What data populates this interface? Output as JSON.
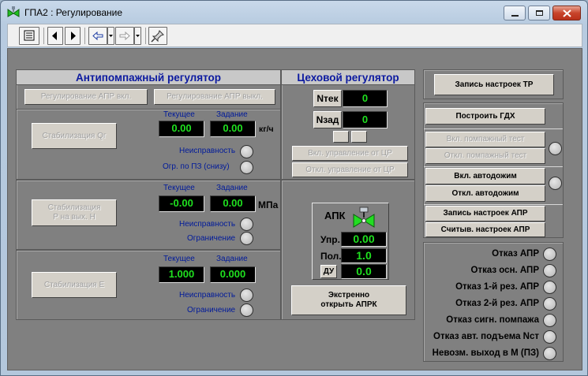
{
  "window": {
    "title": "ГПА2 : Регулирование"
  },
  "antisurge": {
    "header": "Антипомпажный регулятор",
    "btn_apr_on": "Регулирование АПР вкл.",
    "btn_apr_off": "Регулирование АПР выкл.",
    "col_current": "Текущее",
    "col_setpoint": "Задание",
    "blocks": [
      {
        "button": "Стабилизация Qг",
        "current": "0.00",
        "setpoint": "0.00",
        "unit": "кг/ч",
        "lamp1": "Неисправность",
        "lamp2": "Огр. по ПЗ (снизу)"
      },
      {
        "button": "Стабилизация\nР на вых. Н",
        "current": "-0.00",
        "setpoint": "0.00",
        "unit": "МПа",
        "lamp1": "Неисправность",
        "lamp2": "Ограничение"
      },
      {
        "button": "Стабилизация Е",
        "current": "1.000",
        "setpoint": "0.000",
        "unit": "",
        "lamp1": "Неисправность",
        "lamp2": "Ограничение"
      }
    ]
  },
  "shop": {
    "header": "Цеховой регулятор",
    "ntek_label": "Nтек",
    "ntek_value": "0",
    "nzad_label": "Nзад",
    "nzad_value": "0",
    "btn_ctrl_on": "Вкл. управление от ЦР",
    "btn_ctrl_off": "Откл. управление от ЦР"
  },
  "apk": {
    "title": "АПК",
    "upr_label": "Упр.",
    "upr_value": "0.00",
    "pol_label": "Пол.",
    "pol_value": "1.0",
    "du_label": "ДУ",
    "du_value": "0.0",
    "emergency_btn": "Экстренно\nоткрыть АПРК"
  },
  "right": {
    "btn_write_tr": "Запись настроек ТР",
    "btn_build_gdh": "Построить ГДХ",
    "btn_surge_test_on": "Вкл. помпажный тест",
    "btn_surge_test_off": "Откл. помпажный тест",
    "btn_autoclamp_on": "Вкл. автодожим",
    "btn_autoclamp_off": "Откл. автодожим",
    "btn_write_apr": "Запись настроек АПР",
    "btn_read_apr": "Считыв. настроек АПР",
    "faults": [
      "Отказ АПР",
      "Отказ осн. АПР",
      "Отказ 1-й рез. АПР",
      "Отказ 2-й рез. АПР",
      "Отказ сигн. помпажа",
      "Отказ авт. подъема Nст",
      "Невозм. выход в М (ПЗ)"
    ]
  }
}
